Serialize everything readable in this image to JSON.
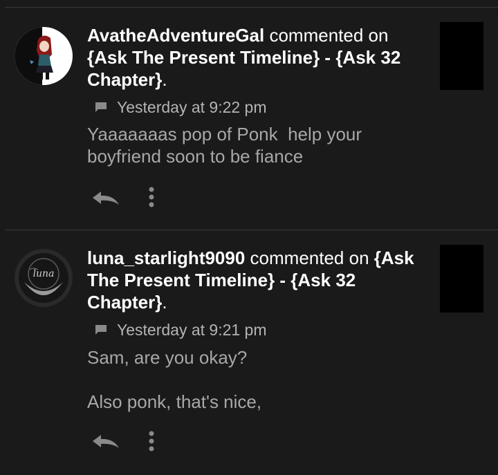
{
  "notifications": [
    {
      "username": "AvatheAdventureGal",
      "action": "commented on",
      "target": "{Ask The Present Timeline} - {Ask 32 Chapter}",
      "period": ".",
      "time": "Yesterday at 9:22 pm",
      "message": "Yaaaaaaas pop of Ponk  help your boyfriend soon to be fiance",
      "avatar_icon": "anime-character-avatar",
      "reply_icon": "reply-arrow-icon",
      "more_icon": "vertical-dots-icon"
    },
    {
      "username": "luna_starlight9090",
      "action": "commented on",
      "target": "{Ask The Present Timeline} - {Ask 32 Chapter}",
      "period": ".",
      "time": "Yesterday at 9:21 pm",
      "message": "Sam, are you okay?\n\nAlso ponk, that's nice,",
      "avatar_icon": "luna-moon-avatar",
      "reply_icon": "reply-arrow-icon",
      "more_icon": "vertical-dots-icon"
    }
  ],
  "colors": {
    "background": "#1a1a1a",
    "primary_text": "#ffffff",
    "secondary_text": "#a8a8a8",
    "icon": "#8a8a8a",
    "divider": "#3a3a3a"
  }
}
